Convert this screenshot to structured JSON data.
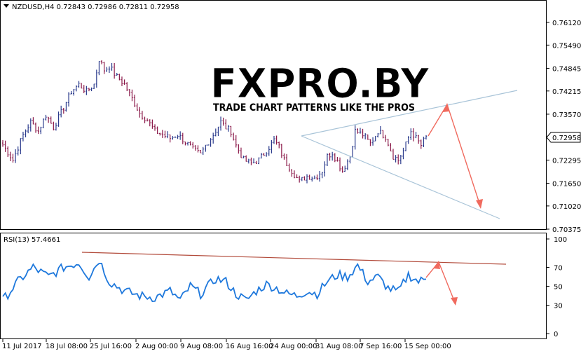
{
  "main_chart": {
    "header": "NZDUSD,H4  0.72843 0.72986 0.72811 0.72958",
    "price_ticks": [
      "0.76120",
      "0.75490",
      "0.74845",
      "0.74215",
      "0.73570",
      "0.72958",
      "0.72295",
      "0.71650",
      "0.71020",
      "0.70375"
    ],
    "current_price": "0.72958"
  },
  "watermark": {
    "logo_text": "FXPRO.BY",
    "tagline": "TRADE CHART PATTERNS LIKE THE PROS"
  },
  "rsi_panel": {
    "header": "RSI(13) 57.4661",
    "ticks": [
      "100",
      "70",
      "50",
      "30",
      "0"
    ]
  },
  "time_axis": {
    "labels": [
      "11 Jul 2017",
      "18 Jul 08:00",
      "25 Jul 16:00",
      "2 Aug 00:00",
      "9 Aug 08:00",
      "16 Aug 16:00",
      "24 Aug 00:00",
      "31 Aug 08:00",
      "7 Sep 16:00",
      "15 Sep 00:00"
    ]
  },
  "chart_data": [
    {
      "type": "candlestick",
      "symbol": "NZDUSD",
      "timeframe": "H4",
      "ylim": [
        0.7022,
        0.7645
      ],
      "current_price": 0.72958,
      "colors": {
        "bullish": "#2a3a8c",
        "bearish": "#8b1a4a",
        "pattern_lines": "#a9c4d8",
        "forecast_arrows": "#f06a5e"
      },
      "anchor_closes": [
        [
          0,
          0.7272
        ],
        [
          4,
          0.723
        ],
        [
          8,
          0.73
        ],
        [
          11,
          0.7335
        ],
        [
          14,
          0.731
        ],
        [
          17,
          0.7355
        ],
        [
          20,
          0.732
        ],
        [
          24,
          0.7375
        ],
        [
          27,
          0.742
        ],
        [
          30,
          0.744
        ],
        [
          33,
          0.742
        ],
        [
          36,
          0.744
        ],
        [
          38,
          0.751
        ],
        [
          40,
          0.748
        ],
        [
          42,
          0.749
        ],
        [
          45,
          0.746
        ],
        [
          48,
          0.744
        ],
        [
          51,
          0.74
        ],
        [
          54,
          0.736
        ],
        [
          57,
          0.734
        ],
        [
          60,
          0.731
        ],
        [
          63,
          0.73
        ],
        [
          66,
          0.729
        ],
        [
          69,
          0.73
        ],
        [
          72,
          0.728
        ],
        [
          75,
          0.726
        ],
        [
          78,
          0.7245
        ],
        [
          80,
          0.727
        ],
        [
          83,
          0.73
        ],
        [
          86,
          0.7335
        ],
        [
          88,
          0.732
        ],
        [
          90,
          0.731
        ],
        [
          92,
          0.727
        ],
        [
          95,
          0.723
        ],
        [
          98,
          0.722
        ],
        [
          101,
          0.723
        ],
        [
          104,
          0.7255
        ],
        [
          107,
          0.7285
        ],
        [
          109,
          0.7265
        ],
        [
          111,
          0.723
        ],
        [
          114,
          0.72
        ],
        [
          117,
          0.717
        ],
        [
          120,
          0.7185
        ],
        [
          123,
          0.718
        ],
        [
          126,
          0.72
        ],
        [
          128,
          0.724
        ],
        [
          130,
          0.725
        ],
        [
          132,
          0.7225
        ],
        [
          134,
          0.72
        ],
        [
          137,
          0.724
        ],
        [
          139,
          0.731
        ],
        [
          142,
          0.73
        ],
        [
          145,
          0.7275
        ],
        [
          148,
          0.731
        ],
        [
          151,
          0.7295
        ],
        [
          154,
          0.724
        ],
        [
          156,
          0.723
        ],
        [
          158,
          0.7255
        ],
        [
          161,
          0.731
        ],
        [
          163,
          0.729
        ],
        [
          165,
          0.727
        ],
        [
          167,
          0.7296
        ]
      ],
      "pattern": "expanding triangle (broadening formation)"
    },
    {
      "type": "line",
      "name": "RSI(13)",
      "last_value": 57.4661,
      "ylim": [
        0,
        100
      ],
      "levels": [
        30,
        70
      ],
      "color": "#1e78dc",
      "approximate_values": [
        [
          0,
          35
        ],
        [
          6,
          55
        ],
        [
          12,
          70
        ],
        [
          18,
          60
        ],
        [
          24,
          70
        ],
        [
          30,
          75
        ],
        [
          34,
          60
        ],
        [
          38,
          78
        ],
        [
          42,
          55
        ],
        [
          48,
          45
        ],
        [
          54,
          40
        ],
        [
          60,
          38
        ],
        [
          66,
          45
        ],
        [
          70,
          35
        ],
        [
          74,
          50
        ],
        [
          78,
          42
        ],
        [
          84,
          58
        ],
        [
          88,
          55
        ],
        [
          92,
          42
        ],
        [
          96,
          35
        ],
        [
          100,
          45
        ],
        [
          104,
          52
        ],
        [
          108,
          48
        ],
        [
          112,
          42
        ],
        [
          116,
          40
        ],
        [
          120,
          45
        ],
        [
          124,
          42
        ],
        [
          128,
          55
        ],
        [
          132,
          62
        ],
        [
          136,
          60
        ],
        [
          140,
          72
        ],
        [
          144,
          55
        ],
        [
          148,
          60
        ],
        [
          152,
          48
        ],
        [
          156,
          44
        ],
        [
          160,
          62
        ],
        [
          164,
          55
        ],
        [
          167,
          57.47
        ]
      ]
    }
  ]
}
